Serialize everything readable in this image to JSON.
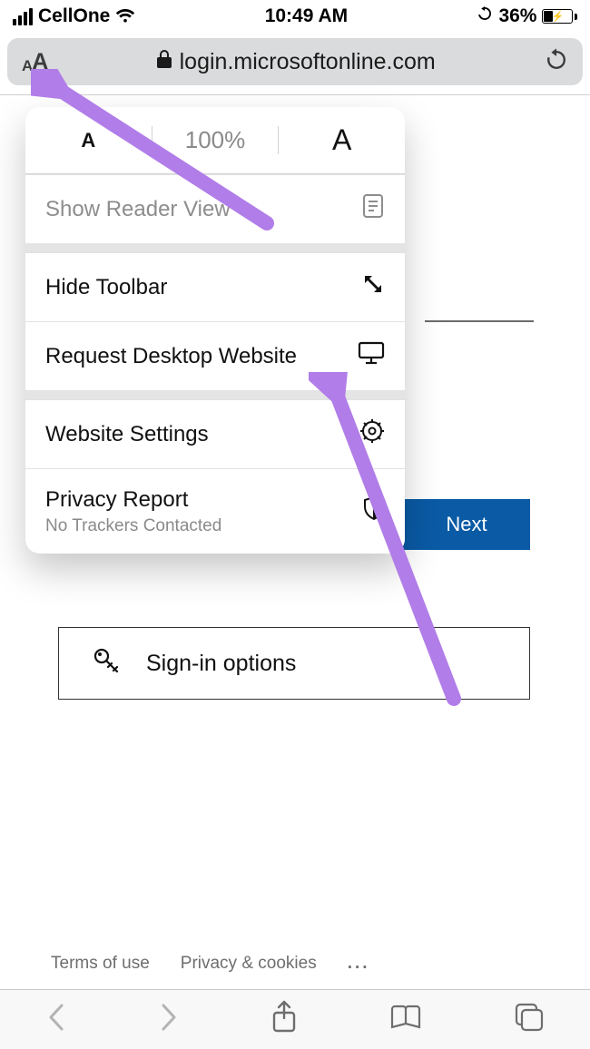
{
  "status": {
    "carrier": "CellOne",
    "time": "10:49 AM",
    "battery_percent": "36%"
  },
  "address_bar": {
    "url_display": "login.microsoftonline.com"
  },
  "popover": {
    "zoom": {
      "decrease": "A",
      "percent": "100%",
      "increase": "A"
    },
    "reader": "Show Reader View",
    "hide_toolbar": "Hide Toolbar",
    "request_desktop": "Request Desktop Website",
    "website_settings": "Website Settings",
    "privacy_report": {
      "title": "Privacy Report",
      "subtitle": "No Trackers Contacted"
    }
  },
  "page": {
    "next_button": "Next",
    "signin_options": "Sign-in options",
    "footer": {
      "terms": "Terms of use",
      "privacy": "Privacy & cookies",
      "more": "..."
    }
  }
}
